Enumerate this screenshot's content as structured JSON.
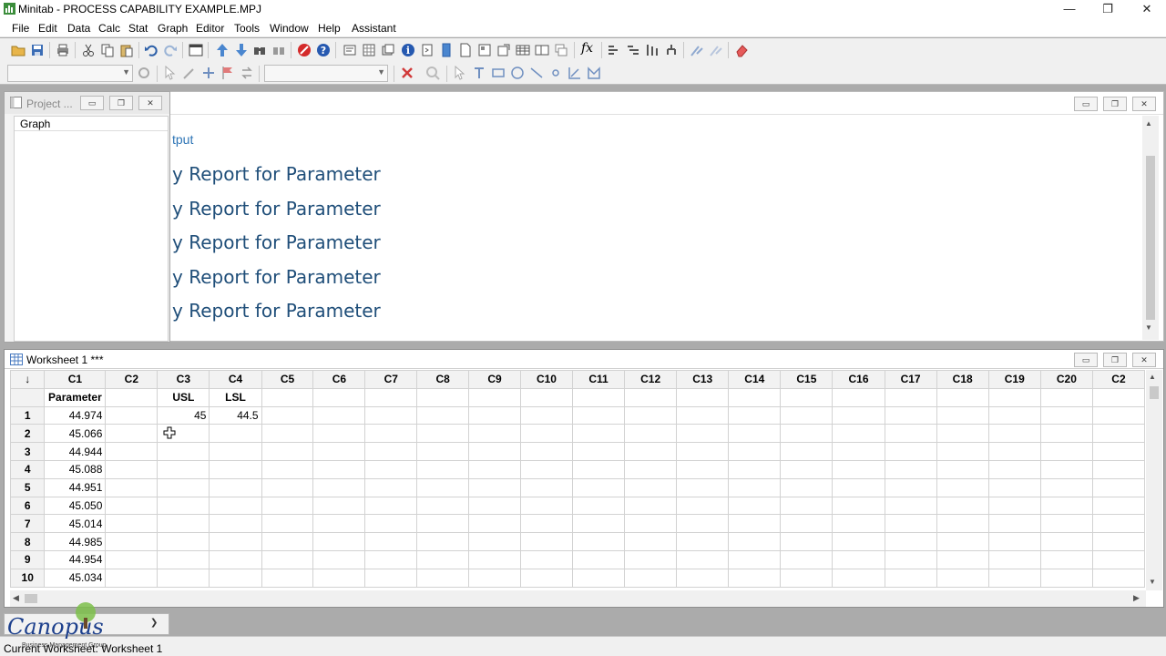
{
  "window": {
    "title": "Minitab - PROCESS CAPABILITY EXAMPLE.MPJ",
    "minimize": "—",
    "restore": "❐",
    "close": "✕"
  },
  "menu": [
    "File",
    "Edit",
    "Data",
    "Calc",
    "Stat",
    "Graph",
    "Editor",
    "Tools",
    "Window",
    "Help",
    "Assistant"
  ],
  "toolbar": {
    "fx_label": "fx"
  },
  "project_manager": {
    "title": "Project ...",
    "items": [
      "Graph"
    ]
  },
  "session": {
    "output_label": "tput",
    "lines": [
      "y Report for Parameter",
      "y Report for Parameter",
      "y Report for Parameter",
      "y Report for Parameter",
      "y Report for Parameter"
    ]
  },
  "worksheet": {
    "title": "Worksheet 1 ***",
    "corner": "↓",
    "columns": [
      "C1",
      "C2",
      "C3",
      "C4",
      "C5",
      "C6",
      "C7",
      "C8",
      "C9",
      "C10",
      "C11",
      "C12",
      "C13",
      "C14",
      "C15",
      "C16",
      "C17",
      "C18",
      "C19",
      "C20",
      "C2"
    ],
    "column_names": [
      "Parameter",
      "",
      "USL",
      "LSL",
      "",
      "",
      "",
      "",
      "",
      "",
      "",
      "",
      "",
      "",
      "",
      "",
      "",
      "",
      "",
      "",
      ""
    ],
    "rows": [
      {
        "n": "1",
        "c1": "44.974",
        "c3": "45",
        "c4": "44.5"
      },
      {
        "n": "2",
        "c1": "45.066",
        "c3": "",
        "c4": ""
      },
      {
        "n": "3",
        "c1": "44.944",
        "c3": "",
        "c4": ""
      },
      {
        "n": "4",
        "c1": "45.088",
        "c3": "",
        "c4": ""
      },
      {
        "n": "5",
        "c1": "44.951",
        "c3": "",
        "c4": ""
      },
      {
        "n": "6",
        "c1": "45.050",
        "c3": "",
        "c4": ""
      },
      {
        "n": "7",
        "c1": "45.014",
        "c3": "",
        "c4": ""
      },
      {
        "n": "8",
        "c1": "44.985",
        "c3": "",
        "c4": ""
      },
      {
        "n": "9",
        "c1": "44.954",
        "c3": "",
        "c4": ""
      },
      {
        "n": "10",
        "c1": "45.034",
        "c3": "",
        "c4": ""
      }
    ]
  },
  "status": {
    "text": "Current Worksheet: Worksheet 1"
  },
  "logo": {
    "text": "Canopus",
    "tagline": "Business Management Group"
  },
  "colors": {
    "session_heading": "#1f4e79",
    "session_output": "#2e75b6",
    "mdi_background": "#ababab"
  }
}
